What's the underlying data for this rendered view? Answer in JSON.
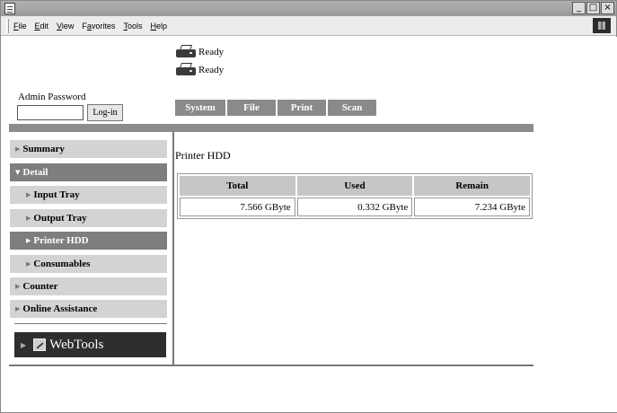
{
  "menu": {
    "items": [
      {
        "label": "File",
        "accel": "F",
        "rest": "ile"
      },
      {
        "label": "Edit",
        "accel": "E",
        "rest": "dit"
      },
      {
        "label": "View",
        "accel": "V",
        "rest": "iew"
      },
      {
        "label": "Favorites",
        "accel": "a",
        "before": "F",
        "rest": "vorites"
      },
      {
        "label": "Tools",
        "accel": "T",
        "rest": "ools"
      },
      {
        "label": "Help",
        "accel": "H",
        "rest": "elp"
      }
    ]
  },
  "window_buttons": {
    "minimize": "_",
    "maximize": "□",
    "close": "×"
  },
  "status": [
    {
      "text": "Ready",
      "icon": "printer-icon"
    },
    {
      "text": "Ready",
      "icon": "printer-icon"
    }
  ],
  "admin": {
    "label": "Admin Password",
    "password_value": "",
    "login_label": "Log-in"
  },
  "tabs": [
    "System",
    "File",
    "Print",
    "Scan"
  ],
  "sidebar": {
    "items": [
      {
        "label": "Summary",
        "arrow": "▶",
        "level": 0,
        "active": false
      },
      {
        "label": "Detail",
        "arrow": "▼",
        "level": 0,
        "active": true
      },
      {
        "label": "Input Tray",
        "arrow": "▶",
        "level": 1,
        "active": false
      },
      {
        "label": "Output Tray",
        "arrow": "▶",
        "level": 1,
        "active": false
      },
      {
        "label": "Printer HDD",
        "arrow": "▶",
        "level": 1,
        "active": true
      },
      {
        "label": "Consumables",
        "arrow": "▶",
        "level": 1,
        "active": false
      },
      {
        "label": "Counter",
        "arrow": "▶",
        "level": 0,
        "active": false
      },
      {
        "label": "Online Assistance",
        "arrow": "▶",
        "level": 0,
        "active": false
      }
    ],
    "webtools_label": "WebTools"
  },
  "main": {
    "title": "Printer HDD",
    "table": {
      "headers": [
        "Total",
        "Used",
        "Remain"
      ],
      "rows": [
        [
          "7.566 GByte",
          "0.332 GByte",
          "7.234 GByte"
        ]
      ]
    }
  }
}
